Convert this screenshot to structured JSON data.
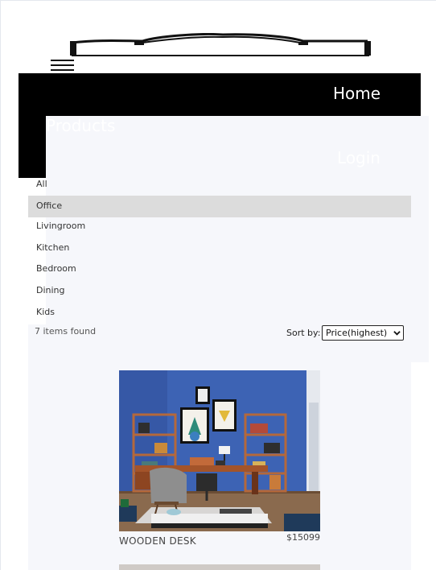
{
  "nav": {
    "links": [
      "Home",
      "Products",
      "Login"
    ]
  },
  "categories": [
    "All",
    "Office",
    "Livingroom",
    "Kitchen",
    "Bedroom",
    "Dining",
    "Kids"
  ],
  "active_category": "Office",
  "toolbar": {
    "count": "7 items found",
    "sort_label": "Sort by:",
    "sort_value": "Price(highest)"
  },
  "product": {
    "name": "WOODEN DESK",
    "price": "$15099"
  },
  "colors": {
    "nav_bg": "#000000",
    "active_bg": "#dcdcdc",
    "content_bg": "#f6f7fb",
    "wall": "#3d63b4"
  }
}
